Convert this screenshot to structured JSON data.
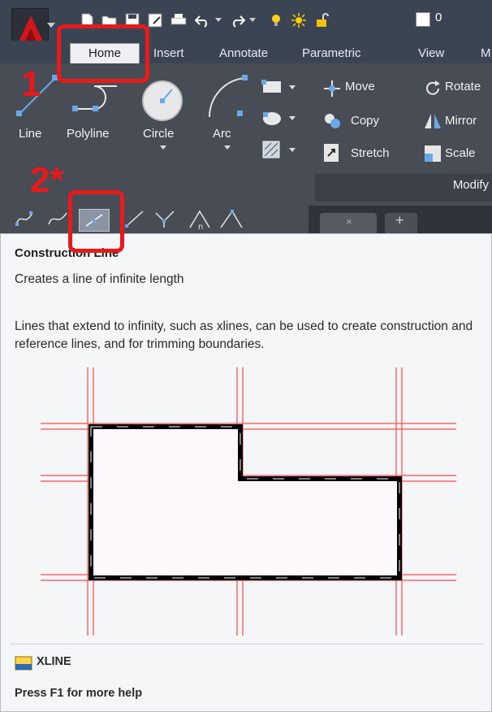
{
  "quick_access": {
    "layer_value": "0",
    "icons": [
      "new-icon",
      "open-icon",
      "save-icon",
      "saveas-icon",
      "print-icon",
      "undo-icon",
      "redo-icon",
      "lightbulb-icon",
      "sun-icon",
      "lock-icon"
    ]
  },
  "tabs": [
    "Home",
    "Insert",
    "Annotate",
    "Parametric",
    "View",
    "M"
  ],
  "draw": {
    "line": "Line",
    "polyline": "Polyline",
    "circle": "Circle",
    "arc": "Arc"
  },
  "modify": {
    "move": "Move",
    "rotate": "Rotate",
    "copy": "Copy",
    "mirror": "Mirror",
    "stretch": "Stretch",
    "scale": "Scale",
    "panel_label": "Modify"
  },
  "doc_tab": {
    "close": "×",
    "plus": "+"
  },
  "tooltip": {
    "title": "Construction Line",
    "description": "Creates a line of infinite length",
    "body": "Lines that extend to infinity, such as xlines, can be used to create construction and reference lines, and for trimming boundaries.",
    "command": "XLINE",
    "help": "Press F1 for more help"
  },
  "annotations": {
    "step1": "1",
    "step2": "2*"
  },
  "colors": {
    "annotation_red": "#e8191a",
    "ribbon_bg": "#474c55",
    "construction_red": "#ff4a4a"
  }
}
